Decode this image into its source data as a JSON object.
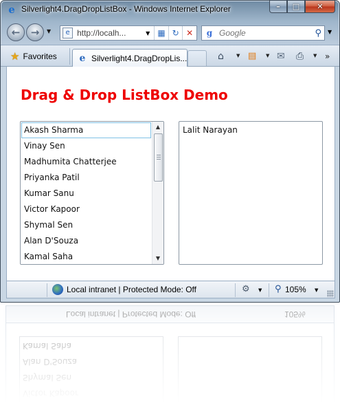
{
  "window": {
    "title": "Silverlight4.DragDropListBox - Windows Internet Explorer",
    "caption": {
      "minimize": "–",
      "maximize": "□",
      "close": "✕"
    }
  },
  "nav": {
    "address_value": "http://localh...",
    "search_placeholder": "Google"
  },
  "tabs": {
    "favorites_label": "Favorites",
    "active_tab_label": "Silverlight4.DragDropLis..."
  },
  "page": {
    "title": "Drag & Drop ListBox Demo",
    "left_list": [
      "Akash Sharma",
      "Vinay Sen",
      "Madhumita Chatterjee",
      "Priyanka Patil",
      "Kumar Sanu",
      "Victor Kapoor",
      "Shymal Sen",
      "Alan D'Souza",
      "Kamal Saha"
    ],
    "left_selected_index": 0,
    "right_list": [
      "Lalit Narayan"
    ]
  },
  "status": {
    "zone_text": "Local intranet | Protected Mode: Off",
    "zoom_text": "105%"
  },
  "icons": {
    "back": "back-arrow-icon",
    "forward": "forward-arrow-icon",
    "refresh": "refresh-icon",
    "stop": "stop-icon",
    "search": "search-icon",
    "favorites": "star-icon",
    "home": "home-icon",
    "feeds": "rss-feed-icon",
    "mail": "mail-icon",
    "print": "printer-icon",
    "zone": "globe-icon",
    "security": "security-icon",
    "zoom": "zoom-icon"
  },
  "colors": {
    "page_title": "#ee0000",
    "selected_border": "#7fc1e6",
    "chrome": "#b9cadb"
  }
}
